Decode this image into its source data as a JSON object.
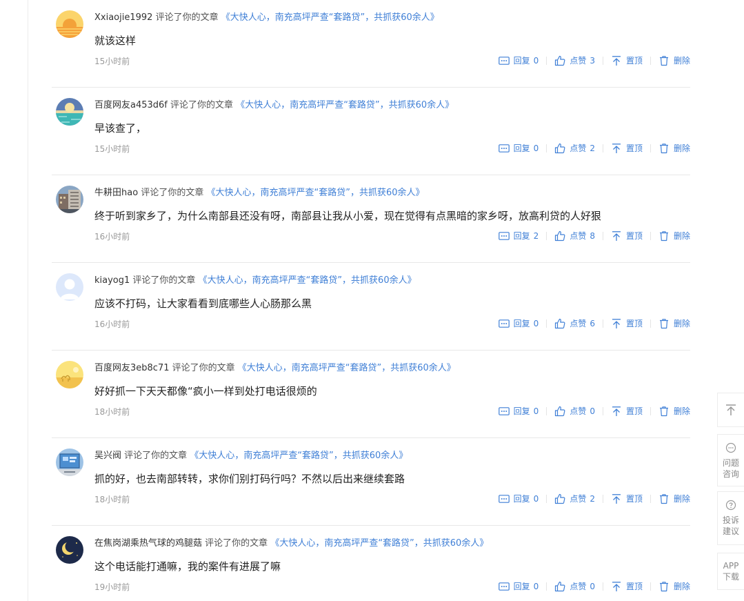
{
  "labels": {
    "verb": "评论了你的文章",
    "reply": "回复",
    "like": "点赞",
    "top": "置顶",
    "delete": "删除"
  },
  "comments": [
    {
      "user": "Xxiaojie1992",
      "article": "《大快人心，南充高坪严查“套路贷”，共抓获60余人》",
      "content": "就该这样",
      "time": "15小时前",
      "replies": "0",
      "likes": "3",
      "avatar": "sunset"
    },
    {
      "user": "百度网友a453d6f",
      "article": "《大快人心，南充高坪严查“套路贷”，共抓获60余人》",
      "content": "早该查了，",
      "time": "15小时前",
      "replies": "0",
      "likes": "2",
      "avatar": "sea-sun"
    },
    {
      "user": "牛耕田hao",
      "article": "《大快人心，南充高坪严查“套路贷”，共抓获60余人》",
      "content": "终于听到家乡了，为什么南部县还没有呀，南部县让我从小爱，现在觉得有点黑暗的家乡呀，放高利贷的人好狠",
      "time": "16小时前",
      "replies": "2",
      "likes": "8",
      "avatar": "building-photo"
    },
    {
      "user": "kiayog1",
      "article": "《大快人心，南充高坪严查“套路贷”，共抓获60余人》",
      "content": "应该不打码，让大家看看到底哪些人心肠那么黑",
      "time": "16小时前",
      "replies": "0",
      "likes": "6",
      "avatar": "default-person"
    },
    {
      "user": "百度网友3eb8c71",
      "article": "《大快人心，南充高坪严查“套路贷”，共抓获60余人》",
      "content": "好好抓一下天天都像“疯小一样到处打电话很烦的",
      "time": "18小时前",
      "replies": "0",
      "likes": "0",
      "avatar": "desert-camel"
    },
    {
      "user": "吴兴阀",
      "article": "《大快人心，南充高坪严查“套路贷”，共抓获60余人》",
      "content": "抓的好，也去南部转转，求你们别打码行吗？不然以后出来继续套路",
      "time": "18小时前",
      "replies": "0",
      "likes": "2",
      "avatar": "screen-photo"
    },
    {
      "user": "在焦岗湖乘热气球的鸡腿菇",
      "article": "《大快人心，南充高坪严查“套路贷”，共抓获60余人》",
      "content": "这个电话能打通嘛，我的案件有进展了嘛",
      "time": "19小时前",
      "replies": "0",
      "likes": "0",
      "avatar": "moon-night"
    }
  ],
  "sidebar": {
    "question_label": "问题咨询",
    "complaint_label": "投诉建议",
    "app_label": "APP下载"
  },
  "colors": {
    "link": "#3f7fd6",
    "muted": "#999999",
    "divider": "#e8e8e8"
  }
}
